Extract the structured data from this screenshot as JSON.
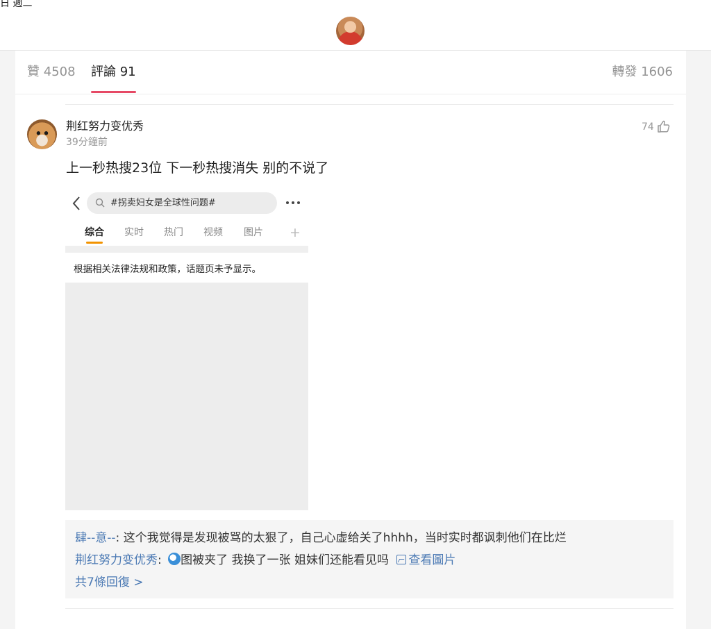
{
  "topbar": {
    "date_text": "日 週二"
  },
  "tabs": {
    "likes": "贊 4508",
    "comments": "評論 91",
    "reposts": "轉發 1606",
    "active_color": "#e64965"
  },
  "comment": {
    "author": "荆红努力变优秀",
    "time": "39分鐘前",
    "like_count": "74",
    "text": "上一秒热搜23位 下一秒热搜消失 别的不说了"
  },
  "embedded_screenshot": {
    "search_text": "#拐卖妇女是全球性问题#",
    "tabs": [
      "综合",
      "实时",
      "热门",
      "视频",
      "图片"
    ],
    "notice": "根据相关法律法规和政策，话题页未予显示。",
    "underline_color": "#f29300"
  },
  "replies": {
    "items": [
      {
        "author": "肆--意--",
        "text": ": 这个我觉得是发现被骂的太狠了，自己心虚给关了hhhh，当时实时都讽刺他们在比烂"
      },
      {
        "author": "荆红努力变优秀",
        "text": ": ",
        "text2": "图被夹了 我换了一张 姐妹们还能看见吗 ",
        "link": "查看圖片"
      }
    ],
    "total": "共7條回復 >",
    "link_color": "#4c7ab4"
  }
}
